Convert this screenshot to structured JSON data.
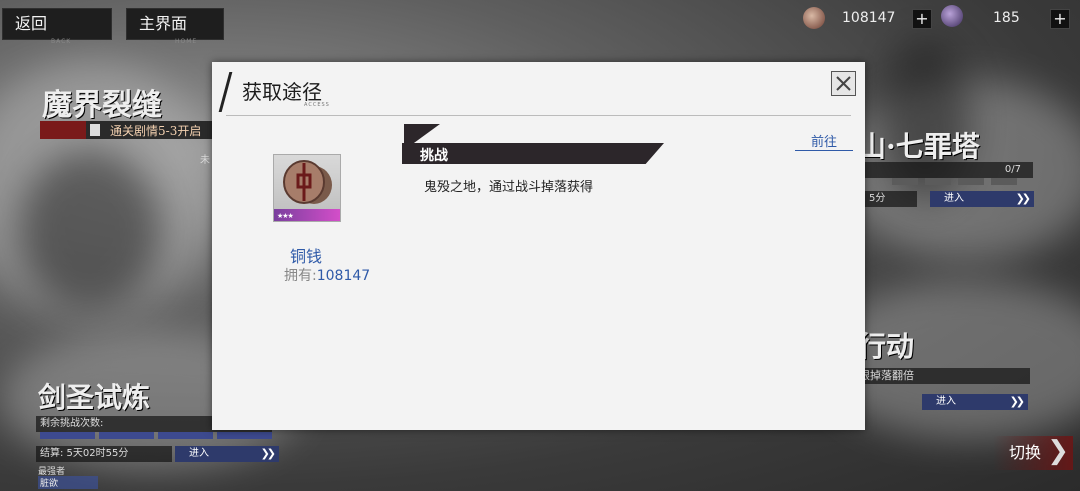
{
  "top_bar": {
    "back_label": "返回",
    "back_sub": "BACK",
    "home_label": "主界面",
    "home_sub": "HOME",
    "coins": "108147",
    "gems": "185"
  },
  "background": {
    "left_top": {
      "title": "魔界裂缝",
      "unlock_text": "通关剧情5-3开启",
      "status": "未"
    },
    "right_top": {
      "title": "山·七罪塔",
      "progress": "0/7",
      "time_text": "5分",
      "enter_label": "进入"
    },
    "right_mid": {
      "title": "行动",
      "desc": "限掉落翻倍",
      "enter_label": "进入"
    },
    "left_bottom": {
      "title": "剑圣试炼",
      "remaining_label": "剩余挑战次数:",
      "settle_label": "结算: 5天02时55分",
      "enter_label": "进入",
      "strongest_label": "最强者",
      "strongest_name": "脏欲"
    },
    "switch_label": "切换"
  },
  "dialog": {
    "title": "获取途径",
    "title_sub": "ACCESS",
    "item": {
      "name": "铜钱",
      "owned_label": "拥有:",
      "owned_value": "108147",
      "stars": "★★★"
    },
    "route": {
      "label": "挑战",
      "description": "鬼殁之地，通过战斗掉落获得",
      "goto_label": "前往"
    }
  }
}
